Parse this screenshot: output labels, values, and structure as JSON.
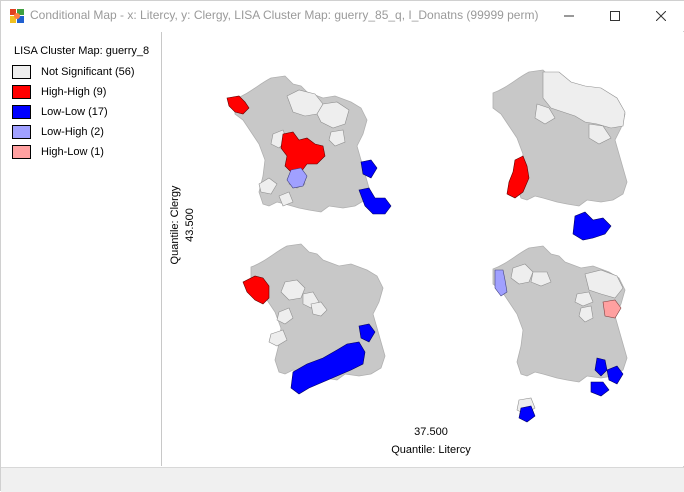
{
  "window": {
    "title": "Conditional Map - x: Litercy, y: Clergy,  LISA Cluster Map: guerry_85_q, I_Donatns (99999 perm)",
    "icon": "geoda-app-icon"
  },
  "legend": {
    "title": "LISA Cluster Map: guerry_8",
    "items": [
      {
        "label": "Not Significant (56)",
        "color": "#eeeeee"
      },
      {
        "label": "High-High (9)",
        "color": "#ff0000"
      },
      {
        "label": "Low-Low (17)",
        "color": "#0000ff"
      },
      {
        "label": "Low-High (2)",
        "color": "#a0a0ff"
      },
      {
        "label": "High-Low (1)",
        "color": "#ffa0a0"
      }
    ]
  },
  "axes": {
    "y_label": "Quantile: Clergy",
    "y_cut": "43.500",
    "x_cut": "37.500",
    "x_label": "Quantile: Litercy"
  },
  "colors": {
    "undefined_region": "#c8c8c8",
    "region_border": "#909090"
  }
}
